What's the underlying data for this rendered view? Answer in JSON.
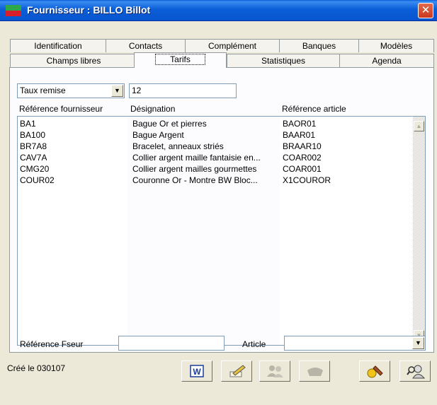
{
  "window": {
    "title": "Fournisseur : BILLO Billot"
  },
  "tabs_row1": [
    {
      "label": "Identification"
    },
    {
      "label": "Contacts"
    },
    {
      "label": "Complément"
    },
    {
      "label": "Banques"
    },
    {
      "label": "Modèles"
    }
  ],
  "tabs_row2": [
    {
      "label": "Champs libres"
    },
    {
      "label": "Tarifs",
      "active": true
    },
    {
      "label": "Statistiques"
    },
    {
      "label": "Agenda"
    }
  ],
  "filter": {
    "type_value": "Taux remise",
    "value": "12"
  },
  "columns": {
    "ref_fournisseur": "Référence fournisseur",
    "designation": "Désignation",
    "ref_article": "Référence article"
  },
  "rows": [
    {
      "ref": "BA1",
      "designation": "Bague Or et pierres",
      "article": "BAOR01"
    },
    {
      "ref": "BA100",
      "designation": "Bague Argent",
      "article": "BAAR01"
    },
    {
      "ref": "BR7A8",
      "designation": "Bracelet, anneaux striés",
      "article": "BRAAR10"
    },
    {
      "ref": "CAV7A",
      "designation": "Collier argent maille fantaisie en...",
      "article": "COAR002"
    },
    {
      "ref": "CMG20",
      "designation": "Collier argent mailles gourmettes",
      "article": "COAR001"
    },
    {
      "ref": "COUR02",
      "designation": "Couronne Or - Montre BW Bloc...",
      "article": "X1COUROR"
    }
  ],
  "bottom": {
    "ref_fseur_label": "Référence Fseur",
    "ref_fseur_value": "",
    "article_label": "Article",
    "article_value": ""
  },
  "status": {
    "created": "Créé le 030107"
  },
  "toolbar": [
    {
      "icon": "word-icon",
      "enabled": true
    },
    {
      "icon": "edit-pencil-icon",
      "enabled": true
    },
    {
      "icon": "users-icon",
      "enabled": false
    },
    {
      "icon": "handshake-icon",
      "enabled": false
    },
    {
      "icon": "tools-icon",
      "enabled": true
    },
    {
      "icon": "search-user-icon",
      "enabled": true
    }
  ],
  "colors": {
    "titlebar": "#0a5fd8",
    "window_bg": "#ece9d8",
    "close": "#c9381f"
  }
}
